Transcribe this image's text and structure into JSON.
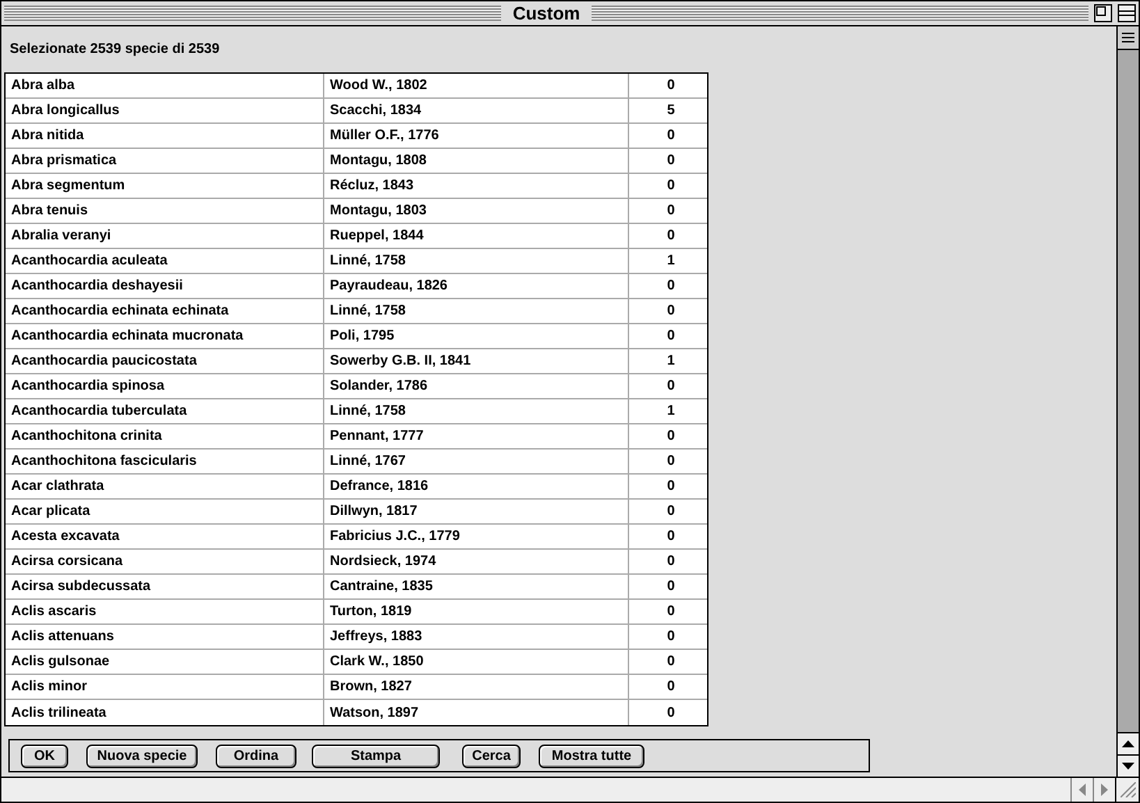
{
  "window": {
    "title": "Custom"
  },
  "summary": "Selezionate 2539 specie di 2539",
  "table": {
    "rows": [
      [
        "Abra alba",
        "Wood W., 1802",
        "0"
      ],
      [
        "Abra longicallus",
        "Scacchi, 1834",
        "5"
      ],
      [
        "Abra nitida",
        "Müller O.F., 1776",
        "0"
      ],
      [
        "Abra prismatica",
        "Montagu, 1808",
        "0"
      ],
      [
        "Abra segmentum",
        "Récluz, 1843",
        "0"
      ],
      [
        "Abra tenuis",
        "Montagu, 1803",
        "0"
      ],
      [
        "Abralia veranyi",
        "Rueppel, 1844",
        "0"
      ],
      [
        "Acanthocardia aculeata",
        "Linné, 1758",
        "1"
      ],
      [
        "Acanthocardia deshayesii",
        "Payraudeau, 1826",
        "0"
      ],
      [
        "Acanthocardia echinata echinata",
        "Linné, 1758",
        "0"
      ],
      [
        "Acanthocardia echinata mucronata",
        "Poli, 1795",
        "0"
      ],
      [
        "Acanthocardia paucicostata",
        "Sowerby G.B. II, 1841",
        "1"
      ],
      [
        "Acanthocardia spinosa",
        "Solander, 1786",
        "0"
      ],
      [
        "Acanthocardia tuberculata",
        "Linné, 1758",
        "1"
      ],
      [
        "Acanthochitona crinita",
        "Pennant, 1777",
        "0"
      ],
      [
        "Acanthochitona fascicularis",
        "Linné, 1767",
        "0"
      ],
      [
        "Acar clathrata",
        "Defrance, 1816",
        "0"
      ],
      [
        "Acar plicata",
        "Dillwyn, 1817",
        "0"
      ],
      [
        "Acesta excavata",
        "Fabricius J.C., 1779",
        "0"
      ],
      [
        "Acirsa corsicana",
        "Nordsieck, 1974",
        "0"
      ],
      [
        "Acirsa subdecussata",
        "Cantraine, 1835",
        "0"
      ],
      [
        "Aclis ascaris",
        "Turton, 1819",
        "0"
      ],
      [
        "Aclis attenuans",
        "Jeffreys, 1883",
        "0"
      ],
      [
        "Aclis gulsonae",
        "Clark W., 1850",
        "0"
      ],
      [
        "Aclis minor",
        "Brown, 1827",
        "0"
      ],
      [
        "Aclis trilineata",
        "Watson, 1897",
        "0"
      ]
    ]
  },
  "buttons": [
    "OK",
    "Nuova specie",
    "Ordina",
    "Stampa",
    "Cerca",
    "Mostra tutte"
  ]
}
